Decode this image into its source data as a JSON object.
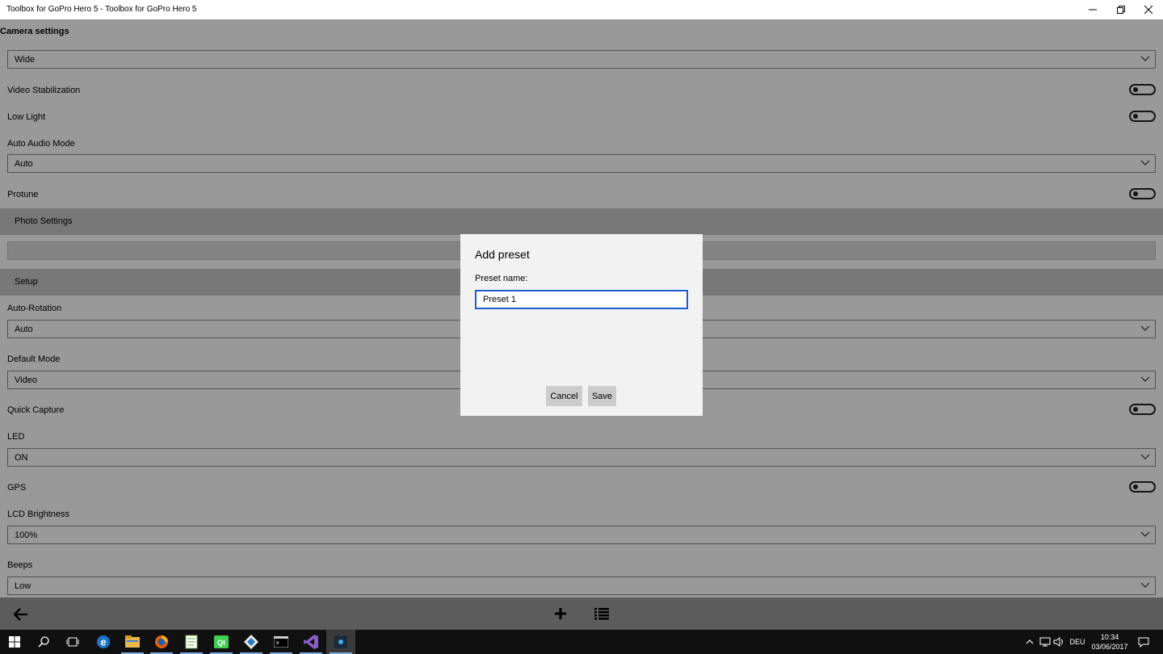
{
  "window": {
    "title": "Toolbox for GoPro Hero 5 - Toolbox for GoPro Hero 5"
  },
  "camera": {
    "heading": "Camera settings",
    "field_of_view": "Wide",
    "video_stabilization_label": "Video Stabilization",
    "low_light_label": "Low Light",
    "auto_audio_label": "Auto Audio Mode",
    "auto_audio_value": "Auto",
    "protune_label": "Protune"
  },
  "photo_section": {
    "title": "Photo Settings"
  },
  "setup_section": {
    "title": "Setup",
    "auto_rotation_label": "Auto-Rotation",
    "auto_rotation_value": "Auto",
    "default_mode_label": "Default Mode",
    "default_mode_value": "Video",
    "quick_capture_label": "Quick Capture",
    "led_label": "LED",
    "led_value": "ON",
    "gps_label": "GPS",
    "lcd_brightness_label": "LCD Brightness",
    "lcd_brightness_value": "100%",
    "beeps_label": "Beeps",
    "beeps_value": "Low"
  },
  "toggles": {
    "video_stabilization": false,
    "low_light": false,
    "protune": false,
    "quick_capture": false,
    "gps": false
  },
  "dialog": {
    "title": "Add preset",
    "field_label": "Preset name:",
    "field_value": "Preset 1",
    "cancel_label": "Cancel",
    "save_label": "Save"
  },
  "taskbar": {
    "language": "DEU",
    "time": "10:34",
    "date": "03/06/2017"
  },
  "colors": {
    "accent": "#1e5bd7",
    "section_bg": "#c8c8c8",
    "taskbar_bg": "#101010"
  }
}
